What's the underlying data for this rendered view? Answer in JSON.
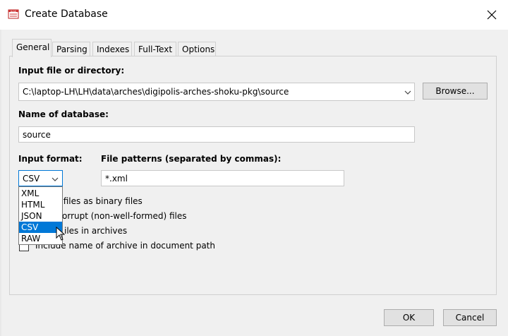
{
  "window": {
    "title": "Create Database",
    "app_icon_text": "BASE"
  },
  "tabs": [
    {
      "label": "General",
      "active": true
    },
    {
      "label": "Parsing",
      "active": false
    },
    {
      "label": "Indexes",
      "active": false
    },
    {
      "label": "Full-Text",
      "active": false
    },
    {
      "label": "Options",
      "active": false
    }
  ],
  "general": {
    "input_label": "Input file or directory:",
    "input_value": "C:\\laptop-LH\\LH\\data\\arches\\digipolis-arches-shoku-pkg\\source",
    "browse_label": "Browse...",
    "name_label": "Name of database:",
    "name_value": "source",
    "format_label": "Input format:",
    "format_value": "CSV",
    "patterns_label": "File patterns (separated by commas):",
    "patterns_value": "*.xml",
    "checkboxes": [
      {
        "label": "ner files as binary files",
        "checked": false
      },
      {
        "label": "orrupt (non-well-formed) files",
        "checked": false
      },
      {
        "label": "iles in archives",
        "checked": false
      },
      {
        "label": "Include name of archive in document path",
        "checked": false
      }
    ],
    "format_options": [
      "XML",
      "HTML",
      "JSON",
      "CSV",
      "RAW"
    ],
    "format_selected": "CSV"
  },
  "footer": {
    "ok_label": "OK",
    "cancel_label": "Cancel"
  },
  "colors": {
    "selection": "#0078d7",
    "dialog_bg": "#f0f0f0",
    "title_bg": "#ffffff"
  },
  "icons": [
    "app-icon",
    "close-icon",
    "chevron-down-icon",
    "mouse-cursor-icon"
  ]
}
